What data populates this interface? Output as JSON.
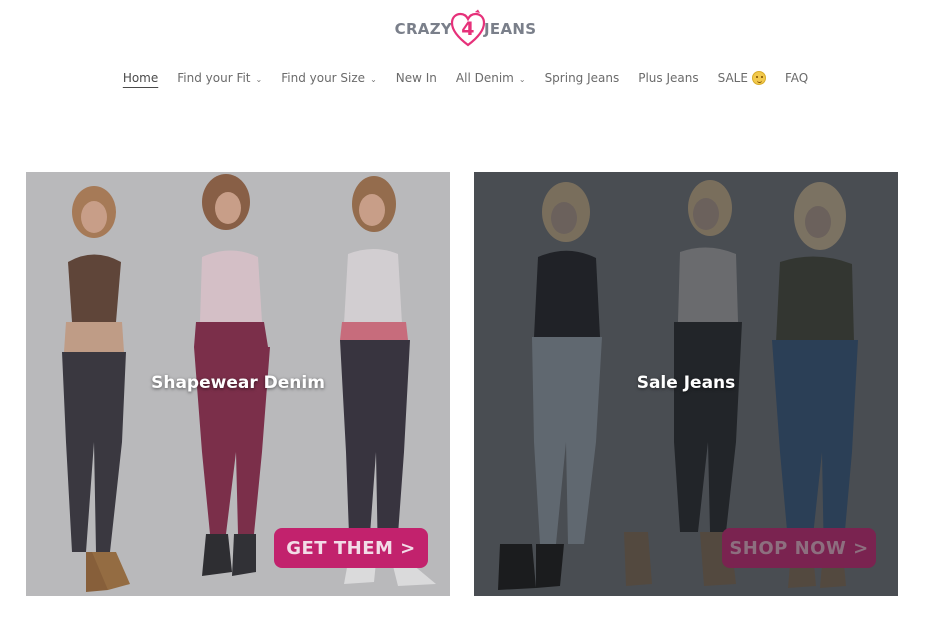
{
  "brand": {
    "logo_left": "CRAZY",
    "logo_number": "4",
    "logo_right": "JEANS",
    "accent_color": "#e6317a"
  },
  "nav": {
    "items": [
      {
        "label": "Home",
        "active": true,
        "has_dropdown": false
      },
      {
        "label": "Find your Fit",
        "active": false,
        "has_dropdown": true
      },
      {
        "label": "Find your Size",
        "active": false,
        "has_dropdown": true
      },
      {
        "label": "New In",
        "active": false,
        "has_dropdown": false
      },
      {
        "label": "All Denim",
        "active": false,
        "has_dropdown": true
      },
      {
        "label": "Spring Jeans",
        "active": false,
        "has_dropdown": false
      },
      {
        "label": "Plus Jeans",
        "active": false,
        "has_dropdown": false
      },
      {
        "label": "SALE",
        "active": false,
        "has_dropdown": false,
        "emoji": "winking-face-icon"
      },
      {
        "label": "FAQ",
        "active": false,
        "has_dropdown": false
      }
    ],
    "dropdown_icon": "chevron-down-icon"
  },
  "collections": [
    {
      "title": "Shapewear Denim",
      "cta": "GET THEM >",
      "cta_color": "#c2226d"
    },
    {
      "title": "Sale Jeans",
      "cta": "SHOP NOW >",
      "cta_color": "#7a2350"
    }
  ]
}
